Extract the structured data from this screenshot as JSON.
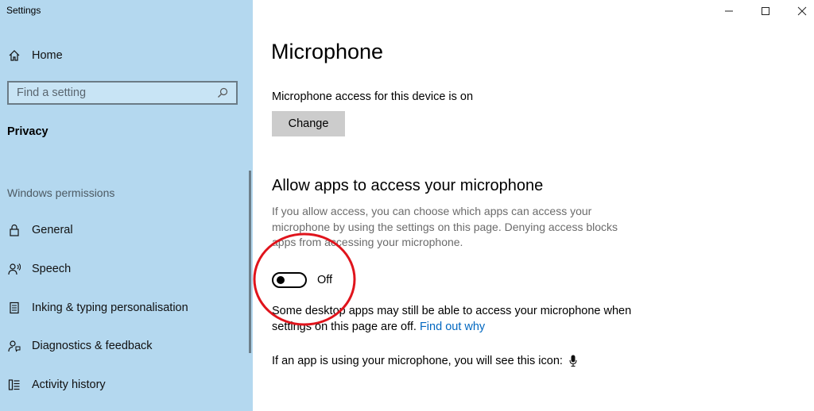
{
  "window": {
    "title": "Settings",
    "controls": {
      "minimize": "—",
      "maximize": "☐",
      "close": "✕"
    }
  },
  "sidebar": {
    "home_label": "Home",
    "search": {
      "placeholder": "Find a setting",
      "value": ""
    },
    "section_heading": "Privacy",
    "group_label": "Windows permissions",
    "items": [
      {
        "label": "General",
        "icon": "lock-icon"
      },
      {
        "label": "Speech",
        "icon": "speech-icon"
      },
      {
        "label": "Inking & typing personalisation",
        "icon": "inking-icon"
      },
      {
        "label": "Diagnostics & feedback",
        "icon": "feedback-icon"
      },
      {
        "label": "Activity history",
        "icon": "activity-history-icon"
      }
    ]
  },
  "main": {
    "title": "Microphone",
    "device_status": "Microphone access for this device is on",
    "change_button": "Change",
    "allow_heading": "Allow apps to access your microphone",
    "allow_description": "If you allow access, you can choose which apps can access your microphone by using the settings on this page. Denying access blocks apps from accessing your microphone.",
    "toggle": {
      "state": "off",
      "label": "Off"
    },
    "desktop_note": "Some desktop apps may still be able to access your microphone when settings on this page are off.",
    "find_out_link": "Find out why",
    "icon_note": "If an app is using your microphone, you will see this icon:"
  },
  "colors": {
    "sidebar_bg": "#b4d8ef",
    "link": "#0067c0",
    "annotation_circle": "#e0141c",
    "button_bg": "#cccccc"
  }
}
